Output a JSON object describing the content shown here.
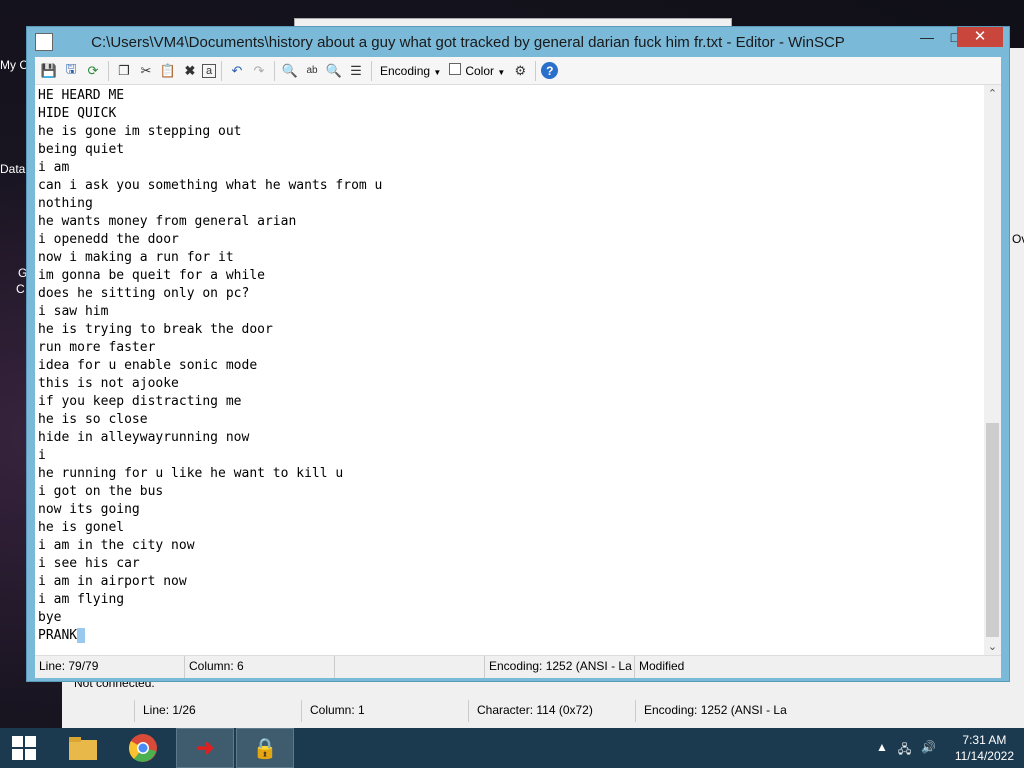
{
  "desktop": {
    "icons": [
      {
        "label": "My C"
      },
      {
        "label": "Data"
      },
      {
        "label": "G"
      },
      {
        "label": "C"
      }
    ]
  },
  "bg_window": {
    "not_connected": "Not connected.",
    "right_label": "Ov",
    "status": [
      "Line: 1/26",
      "Column: 1",
      "Character: 114 (0x72)",
      "Encoding: 1252  (ANSI - La"
    ]
  },
  "editor": {
    "title": "C:\\Users\\VM4\\Documents\\history about a guy what got tracked by general darian fuck him fr.txt - Editor - WinSCP",
    "toolbar": {
      "encoding_label": "Encoding",
      "color_label": "Color"
    },
    "lines": [
      "HE HEARD ME",
      "HIDE QUICK",
      "he is gone im stepping out",
      "being quiet",
      "i am",
      "can i ask you something what he wants from u",
      "nothing",
      "he wants money from general arian",
      "i openedd the door",
      "now i making a run for it",
      "im gonna be queit for a while",
      "does he sitting only on pc?",
      "i saw him",
      "he is trying to break the door",
      "run more faster",
      "idea for u enable sonic mode",
      "this is not ajooke",
      "if you keep distracting me",
      "he is so close",
      "hide in alleywayrunning now",
      "i",
      "he running for u like he want to kill u",
      "i got on the bus",
      "now its going",
      "he is gonel",
      "i am in the city now",
      "i see his car",
      "i am in airport now",
      "i am flying",
      "bye"
    ],
    "last_line": "PRANK",
    "status": {
      "line": "Line: 79/79",
      "column": "Column: 6",
      "blank": "",
      "encoding": "Encoding: 1252  (ANSI - La",
      "modified": "Modified"
    }
  },
  "taskbar": {
    "time": "7:31 AM",
    "date": "11/14/2022"
  },
  "colors": {
    "title_bar": "#7ab9d8",
    "close_button": "#c9463d",
    "taskbar": "#1c3a4f",
    "selection": "#99c9ef"
  }
}
